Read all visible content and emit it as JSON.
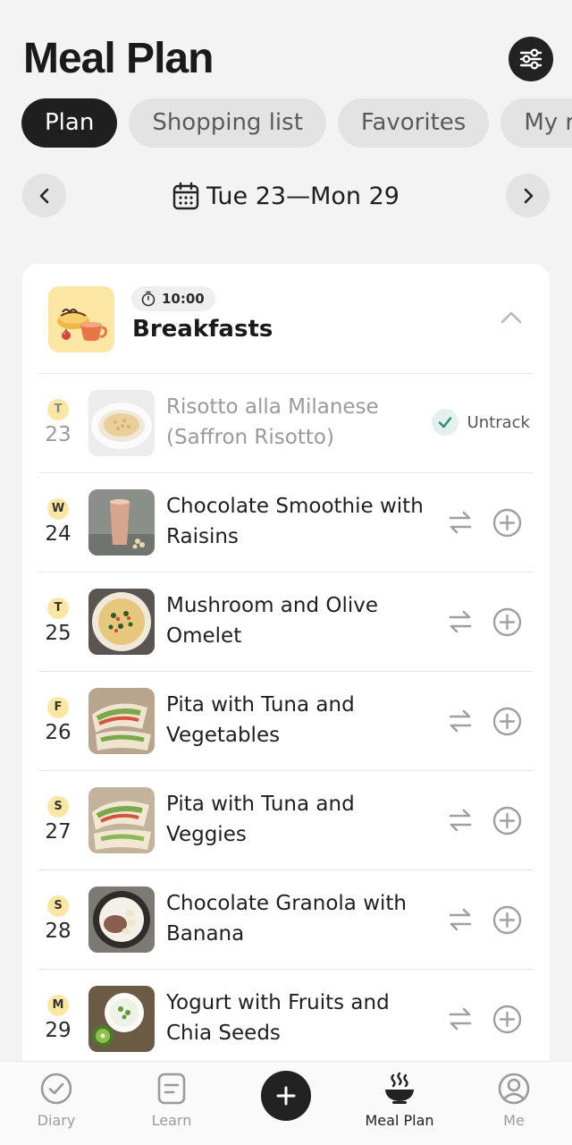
{
  "header": {
    "title": "Meal Plan",
    "filter_icon": "sliders-icon"
  },
  "tabs": [
    {
      "label": "Plan",
      "active": true
    },
    {
      "label": "Shopping list",
      "active": false
    },
    {
      "label": "Favorites",
      "active": false
    },
    {
      "label": "My re",
      "active": false
    }
  ],
  "week": {
    "range": "Tue 23—Mon 29",
    "prev_icon": "chevron-left-icon",
    "next_icon": "chevron-right-icon",
    "calendar_icon": "calendar-icon"
  },
  "meal": {
    "time": "10:00",
    "title": "Breakfasts",
    "rows": [
      {
        "day_letter": "T",
        "day_num": "23",
        "name": "Risotto alla Milanese (Saffron Risotto)",
        "tracked": true,
        "untrack_label": "Untrack"
      },
      {
        "day_letter": "W",
        "day_num": "24",
        "name": "Chocolate Smoothie with Raisins",
        "tracked": false
      },
      {
        "day_letter": "T",
        "day_num": "25",
        "name": "Mushroom and Olive Omelet",
        "tracked": false
      },
      {
        "day_letter": "F",
        "day_num": "26",
        "name": "Pita with Tuna and Vegetables",
        "tracked": false
      },
      {
        "day_letter": "S",
        "day_num": "27",
        "name": "Pita with Tuna and Veggies",
        "tracked": false
      },
      {
        "day_letter": "S",
        "day_num": "28",
        "name": "Chocolate Granola with Banana",
        "tracked": false
      },
      {
        "day_letter": "M",
        "day_num": "29",
        "name": "Yogurt with Fruits and Chia Seeds",
        "tracked": false
      }
    ]
  },
  "nav": {
    "diary": "Diary",
    "learn": "Learn",
    "meal_plan": "Meal Plan",
    "me": "Me"
  },
  "colors": {
    "accent_yellow": "#fbe7a3",
    "dark": "#1f1f1f",
    "check_teal": "#2e8a7e"
  }
}
